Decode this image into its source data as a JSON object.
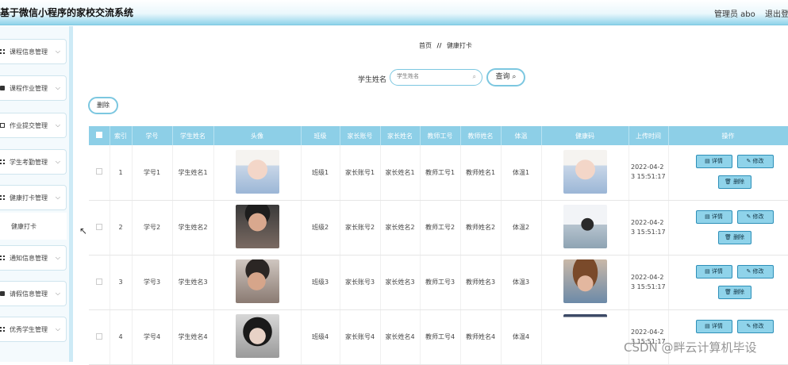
{
  "header": {
    "app_title": "基于微信小程序的家校交流系统",
    "admin_label": "管理员 abo",
    "logout_label": "退出登"
  },
  "sidebar": {
    "items": [
      {
        "label": "课程信息管理",
        "icon": "grid-icon"
      },
      {
        "label": "课程作业管理",
        "icon": "book-icon"
      },
      {
        "label": "作业提交管理",
        "icon": "doc-icon"
      },
      {
        "label": "学生考勤管理",
        "icon": "grid-icon"
      },
      {
        "label": "健康打卡管理",
        "icon": "grid-icon"
      },
      {
        "label": "通知信息管理",
        "icon": "grid-icon"
      },
      {
        "label": "请假信息管理",
        "icon": "book-icon"
      },
      {
        "label": "优秀学生管理",
        "icon": "grid-icon"
      }
    ],
    "sub_item": "健康打卡"
  },
  "breadcrumb": {
    "home": "首页",
    "separator": "//",
    "current": "健康打卡"
  },
  "search": {
    "label": "学生姓名",
    "placeholder": "学生姓名",
    "query_button": "查询"
  },
  "toolbar": {
    "delete_label": "删除"
  },
  "table": {
    "headers": [
      "",
      "索引",
      "学号",
      "学生姓名",
      "头像",
      "班级",
      "家长账号",
      "家长姓名",
      "教师工号",
      "教师姓名",
      "体温",
      "健康码",
      "上传时间",
      "操作"
    ],
    "rows": [
      {
        "index": "1",
        "student_no": "学号1",
        "student_name": "学生姓名1",
        "class": "班级1",
        "parent_account": "家长账号1",
        "parent_name": "家长姓名1",
        "teacher_no": "教师工号1",
        "teacher_name": "教师姓名1",
        "temperature": "体温1",
        "time_line1": "2022-04-2",
        "time_line2": "3 15:51:17"
      },
      {
        "index": "2",
        "student_no": "学号2",
        "student_name": "学生姓名2",
        "class": "班级2",
        "parent_account": "家长账号2",
        "parent_name": "家长姓名2",
        "teacher_no": "教师工号2",
        "teacher_name": "教师姓名2",
        "temperature": "体温2",
        "time_line1": "2022-04-2",
        "time_line2": "3 15:51:17"
      },
      {
        "index": "3",
        "student_no": "学号3",
        "student_name": "学生姓名3",
        "class": "班级3",
        "parent_account": "家长账号3",
        "parent_name": "家长姓名3",
        "teacher_no": "教师工号3",
        "teacher_name": "教师姓名3",
        "temperature": "体温3",
        "time_line1": "2022-04-2",
        "time_line2": "3 15:51:17"
      },
      {
        "index": "4",
        "student_no": "学号4",
        "student_name": "学生姓名4",
        "class": "班级4",
        "parent_account": "家长账号4",
        "parent_name": "家长姓名4",
        "teacher_no": "教师工号4",
        "teacher_name": "教师姓名4",
        "temperature": "体温4",
        "time_line1": "2022-04-2",
        "time_line2": "3 15:51:17"
      }
    ],
    "actions": {
      "detail": "详情",
      "edit": "修改",
      "delete": "删除"
    }
  },
  "watermark": "CSDN @畔云计算机毕设",
  "colors": {
    "accent": "#8dcfe7",
    "button_border": "#2d8fb8",
    "button_fill": "#8fd3ea"
  }
}
